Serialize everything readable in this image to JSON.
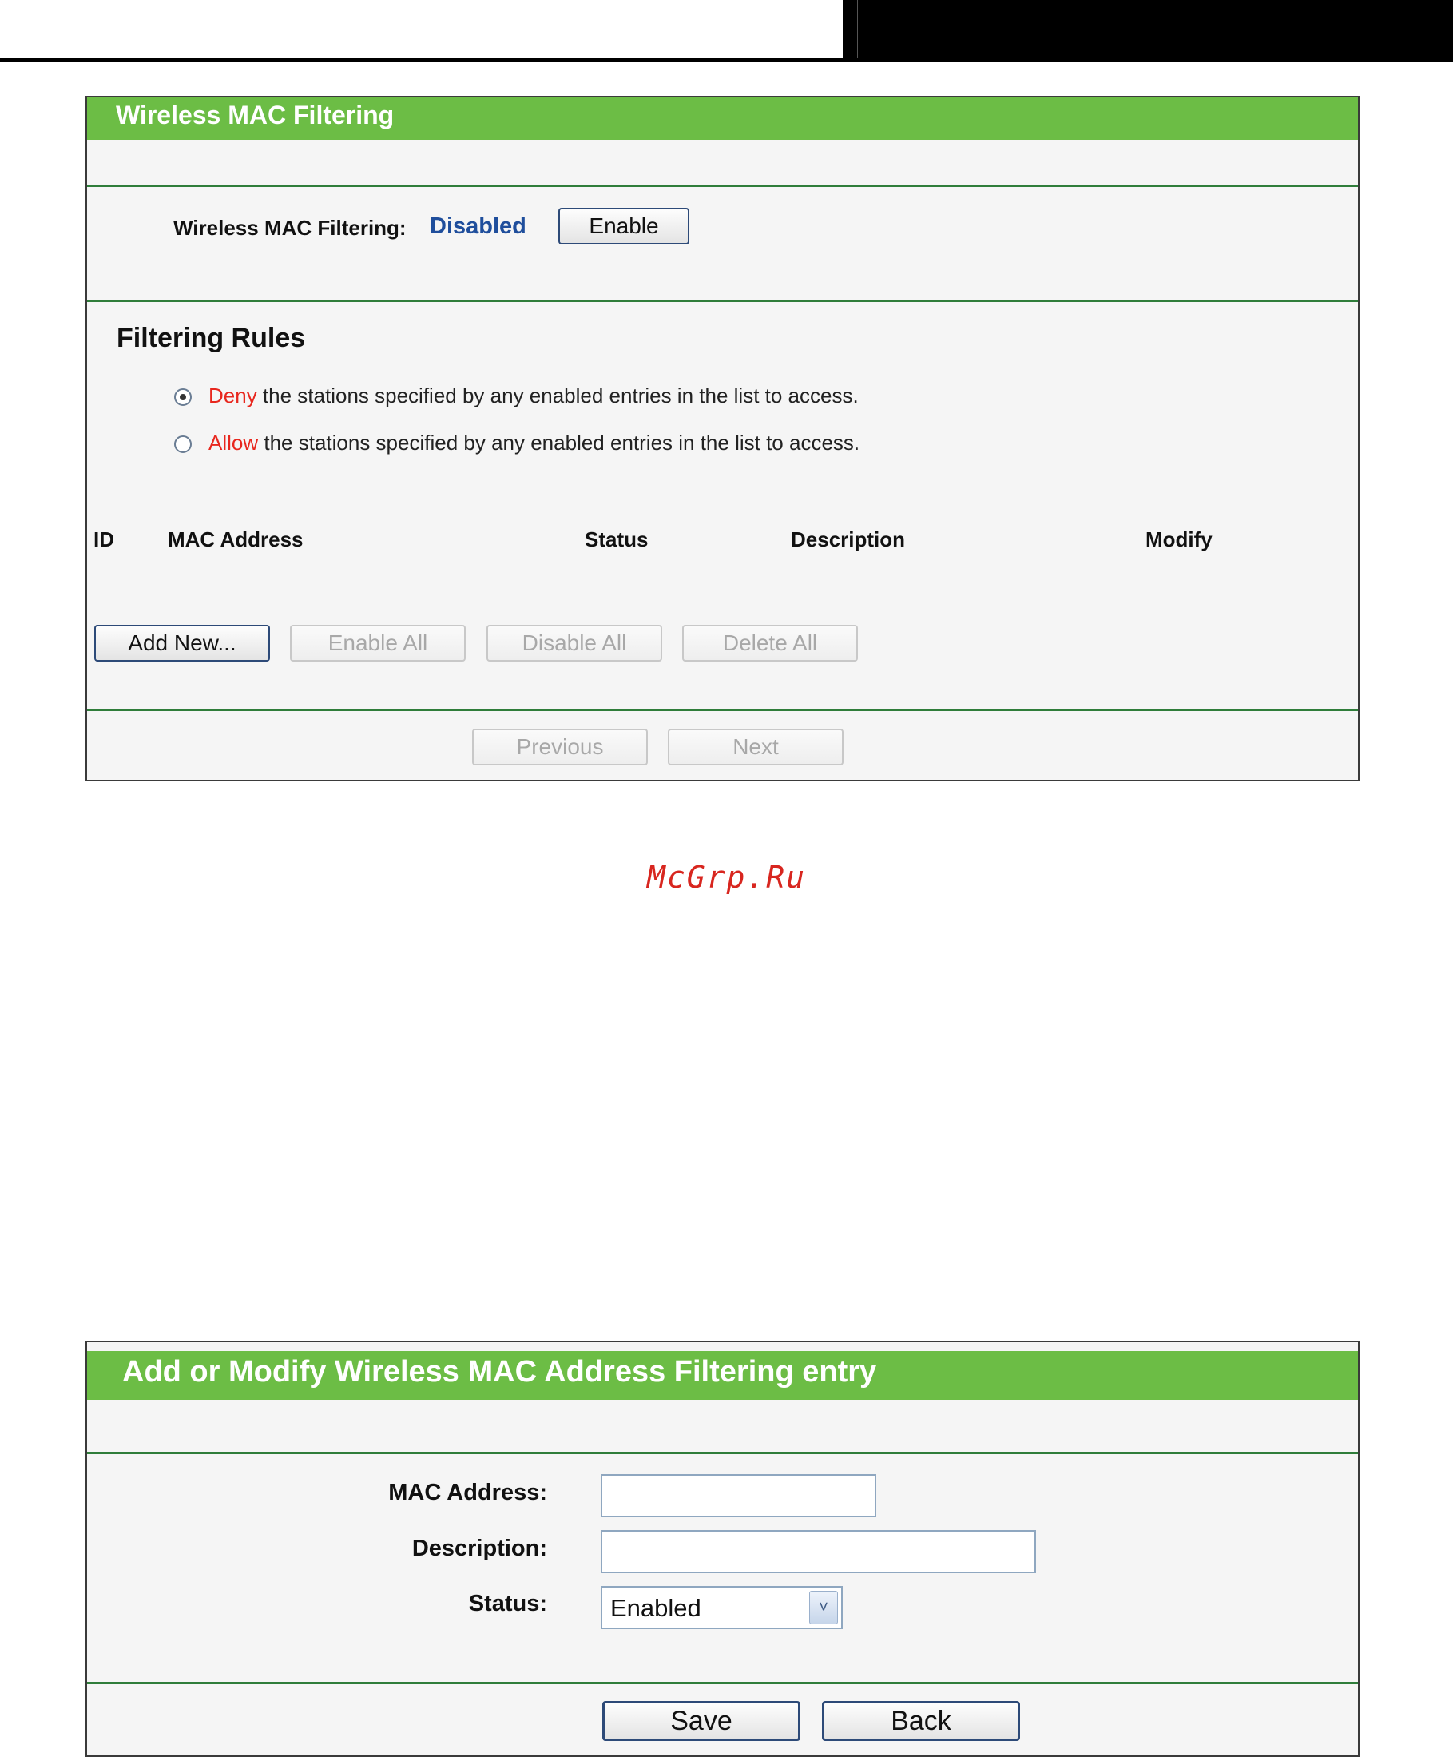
{
  "watermark": "McGrp.Ru",
  "mac_filtering": {
    "title": "Wireless MAC Filtering",
    "status_label": "Wireless MAC Filtering:",
    "status_value": "Disabled",
    "enable_button": "Enable",
    "rules_heading": "Filtering Rules",
    "rules": [
      {
        "keyword": "Deny",
        "text": " the stations specified by any enabled entries in the list to access.",
        "selected": true
      },
      {
        "keyword": "Allow",
        "text": " the stations specified by any enabled entries in the list to access.",
        "selected": false
      }
    ],
    "table_headers": [
      "ID",
      "MAC Address",
      "Status",
      "Description",
      "Modify"
    ],
    "buttons": {
      "add_new": "Add New...",
      "enable_all": "Enable All",
      "disable_all": "Disable All",
      "delete_all": "Delete All"
    },
    "pagination": {
      "previous": "Previous",
      "next": "Next"
    }
  },
  "entry_form": {
    "title": "Add or Modify Wireless MAC Address Filtering entry",
    "mac_label": "MAC Address:",
    "mac_value": "",
    "description_label": "Description:",
    "description_value": "",
    "status_label": "Status:",
    "status_selected": "Enabled",
    "save_button": "Save",
    "back_button": "Back"
  },
  "colors": {
    "header_green": "#6cbd45",
    "divider_green": "#2f7d3a",
    "status_blue": "#1f4e9c",
    "keyword_red": "#e8271e"
  }
}
